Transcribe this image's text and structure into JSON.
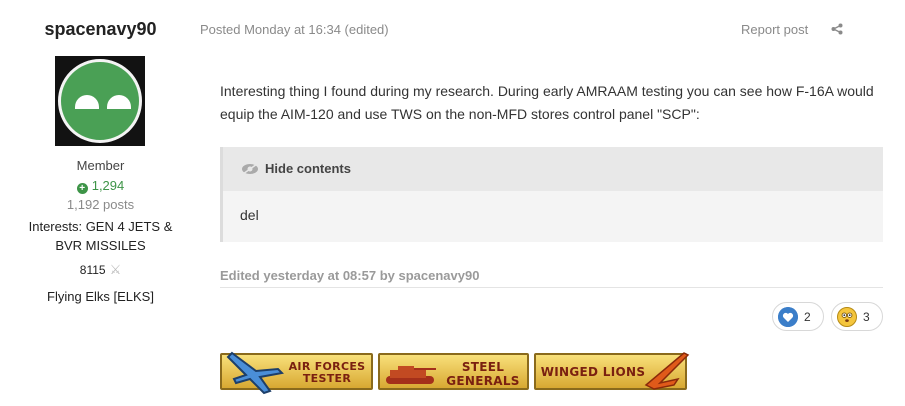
{
  "author": {
    "name": "spacenavy90",
    "rank": "Member",
    "reputation": "1,294",
    "posts": "1,192 posts",
    "interests": "Interests: GEN 4 JETS & BVR MISSILES",
    "badge_number": "8115",
    "clan": "Flying Elks [ELKS]"
  },
  "post": {
    "meta": "Posted Monday at 16:34 (edited)",
    "report_label": "Report post",
    "body": "Interesting thing I found during my research. During early AMRAAM testing you can see how F-16A would equip the AIM-120 and use TWS on the non-MFD stores control panel \"SCP\":",
    "spoiler_label": "Hide contents",
    "spoiler_content": "del",
    "edited_note": "Edited yesterday at 08:57 by spacenavy90"
  },
  "reactions": [
    {
      "type": "like-icon",
      "count": "2"
    },
    {
      "type": "haha-icon",
      "count": "3"
    }
  ],
  "badges": [
    {
      "label": "AIR FORCES TESTER"
    },
    {
      "label": "STEEL GENERALS"
    },
    {
      "label": "WINGED LIONS"
    }
  ],
  "colors": {
    "reputation_green": "#3d9447",
    "avatar_green": "#4aa055",
    "muted_text": "#8a8a8a"
  }
}
